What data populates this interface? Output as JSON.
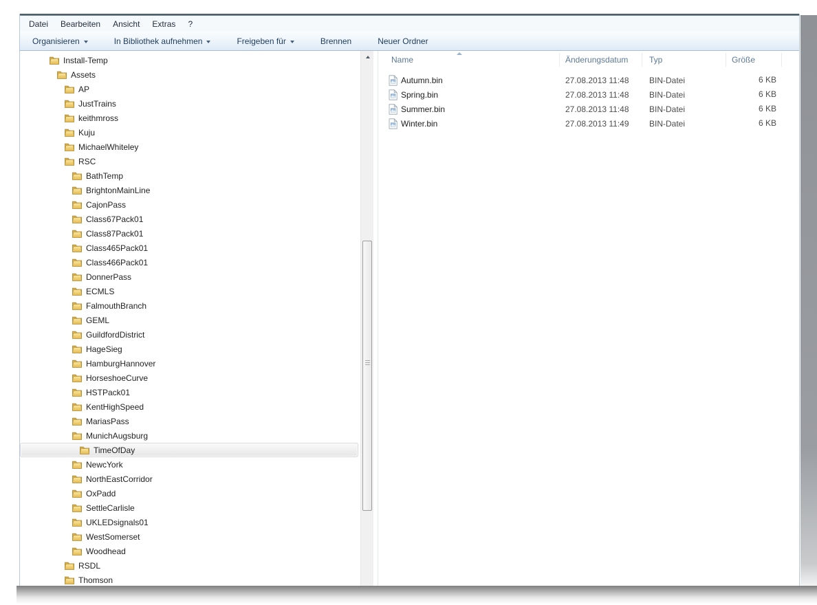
{
  "menubar": {
    "items": [
      "Datei",
      "Bearbeiten",
      "Ansicht",
      "Extras",
      "?"
    ]
  },
  "toolbar": {
    "buttons": [
      {
        "label": "Organisieren",
        "dropdown": true
      },
      {
        "label": "In Bibliothek aufnehmen",
        "dropdown": true
      },
      {
        "label": "Freigeben für",
        "dropdown": true
      },
      {
        "label": "Brennen",
        "dropdown": false
      },
      {
        "label": "Neuer Ordner",
        "dropdown": false
      }
    ]
  },
  "tree": {
    "items": [
      {
        "label": "Install-Temp",
        "level": 0,
        "selected": false
      },
      {
        "label": "Assets",
        "level": 1,
        "selected": false
      },
      {
        "label": "AP",
        "level": 2,
        "selected": false
      },
      {
        "label": "JustTrains",
        "level": 2,
        "selected": false
      },
      {
        "label": "keithmross",
        "level": 2,
        "selected": false
      },
      {
        "label": "Kuju",
        "level": 2,
        "selected": false
      },
      {
        "label": "MichaelWhiteley",
        "level": 2,
        "selected": false
      },
      {
        "label": "RSC",
        "level": 2,
        "selected": false
      },
      {
        "label": "BathTemp",
        "level": 3,
        "selected": false
      },
      {
        "label": "BrightonMainLine",
        "level": 3,
        "selected": false
      },
      {
        "label": "CajonPass",
        "level": 3,
        "selected": false
      },
      {
        "label": "Class67Pack01",
        "level": 3,
        "selected": false
      },
      {
        "label": "Class87Pack01",
        "level": 3,
        "selected": false
      },
      {
        "label": "Class465Pack01",
        "level": 3,
        "selected": false
      },
      {
        "label": "Class466Pack01",
        "level": 3,
        "selected": false
      },
      {
        "label": "DonnerPass",
        "level": 3,
        "selected": false
      },
      {
        "label": "ECMLS",
        "level": 3,
        "selected": false
      },
      {
        "label": "FalmouthBranch",
        "level": 3,
        "selected": false
      },
      {
        "label": "GEML",
        "level": 3,
        "selected": false
      },
      {
        "label": "GuildfordDistrict",
        "level": 3,
        "selected": false
      },
      {
        "label": "HageSieg",
        "level": 3,
        "selected": false
      },
      {
        "label": "HamburgHannover",
        "level": 3,
        "selected": false
      },
      {
        "label": "HorseshoeCurve",
        "level": 3,
        "selected": false
      },
      {
        "label": "HSTPack01",
        "level": 3,
        "selected": false
      },
      {
        "label": "KentHighSpeed",
        "level": 3,
        "selected": false
      },
      {
        "label": "MariasPass",
        "level": 3,
        "selected": false
      },
      {
        "label": "MunichAugsburg",
        "level": 3,
        "selected": false
      },
      {
        "label": "TimeOfDay",
        "level": 4,
        "selected": true
      },
      {
        "label": "NewcYork",
        "level": 3,
        "selected": false
      },
      {
        "label": "NorthEastCorridor",
        "level": 3,
        "selected": false
      },
      {
        "label": "OxPadd",
        "level": 3,
        "selected": false
      },
      {
        "label": "SettleCarlisle",
        "level": 3,
        "selected": false
      },
      {
        "label": "UKLEDsignals01",
        "level": 3,
        "selected": false
      },
      {
        "label": "WestSomerset",
        "level": 3,
        "selected": false
      },
      {
        "label": "Woodhead",
        "level": 3,
        "selected": false
      },
      {
        "label": "RSDL",
        "level": 2,
        "selected": false
      },
      {
        "label": "Thomson",
        "level": 2,
        "selected": false
      }
    ]
  },
  "file_list": {
    "columns": [
      {
        "label": "Name",
        "sorted": "asc"
      },
      {
        "label": "Änderungsdatum",
        "sorted": null
      },
      {
        "label": "Typ",
        "sorted": null
      },
      {
        "label": "Größe",
        "sorted": null
      }
    ],
    "rows": [
      {
        "name": "Autumn.bin",
        "modified": "27.08.2013 11:48",
        "type": "BIN-Datei",
        "size": "6 KB"
      },
      {
        "name": "Spring.bin",
        "modified": "27.08.2013 11:48",
        "type": "BIN-Datei",
        "size": "6 KB"
      },
      {
        "name": "Summer.bin",
        "modified": "27.08.2013 11:48",
        "type": "BIN-Datei",
        "size": "6 KB"
      },
      {
        "name": "Winter.bin",
        "modified": "27.08.2013 11:49",
        "type": "BIN-Datei",
        "size": "6 KB"
      }
    ]
  },
  "colors": {
    "toolbar_bottom_border": "#a9bccd",
    "toolbar_text": "#1e3c5c",
    "header_text": "#5d7a96",
    "selection_gradient_top": "#fafafa",
    "selection_gradient_bottom": "#e6e6e6",
    "selection_border": "#d9d9d9",
    "folder_yellow": "#efd26d",
    "folder_outline": "#ac8429"
  }
}
